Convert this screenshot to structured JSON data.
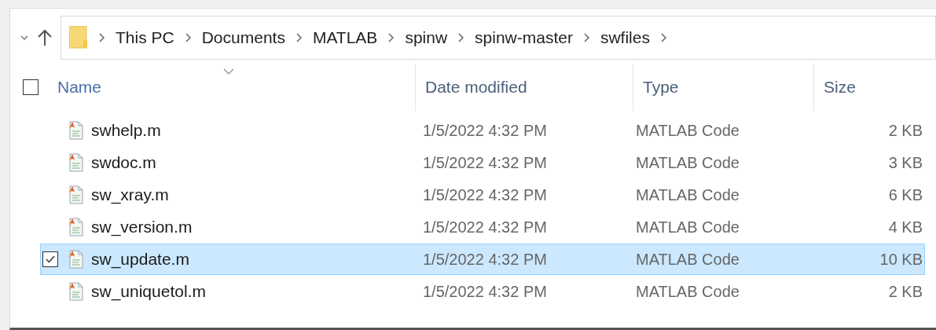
{
  "breadcrumb": [
    "This PC",
    "Documents",
    "MATLAB",
    "spinw",
    "spinw-master",
    "swfiles"
  ],
  "columns": [
    {
      "label": "Name",
      "sorted": true
    },
    {
      "label": "Date modified",
      "sorted": false
    },
    {
      "label": "Type",
      "sorted": false
    },
    {
      "label": "Size",
      "sorted": false
    }
  ],
  "select_all": {
    "checked": false
  },
  "rows": [
    {
      "name": "swhelp.m",
      "date": "1/5/2022 4:32 PM",
      "type": "MATLAB Code",
      "size": "2 KB",
      "selected": false
    },
    {
      "name": "swdoc.m",
      "date": "1/5/2022 4:32 PM",
      "type": "MATLAB Code",
      "size": "3 KB",
      "selected": false
    },
    {
      "name": "sw_xray.m",
      "date": "1/5/2022 4:32 PM",
      "type": "MATLAB Code",
      "size": "6 KB",
      "selected": false
    },
    {
      "name": "sw_version.m",
      "date": "1/5/2022 4:32 PM",
      "type": "MATLAB Code",
      "size": "4 KB",
      "selected": false
    },
    {
      "name": "sw_update.m",
      "date": "1/5/2022 4:32 PM",
      "type": "MATLAB Code",
      "size": "10 KB",
      "selected": true
    },
    {
      "name": "sw_uniquetol.m",
      "date": "1/5/2022 4:32 PM",
      "type": "MATLAB Code",
      "size": "2 KB",
      "selected": false
    }
  ]
}
